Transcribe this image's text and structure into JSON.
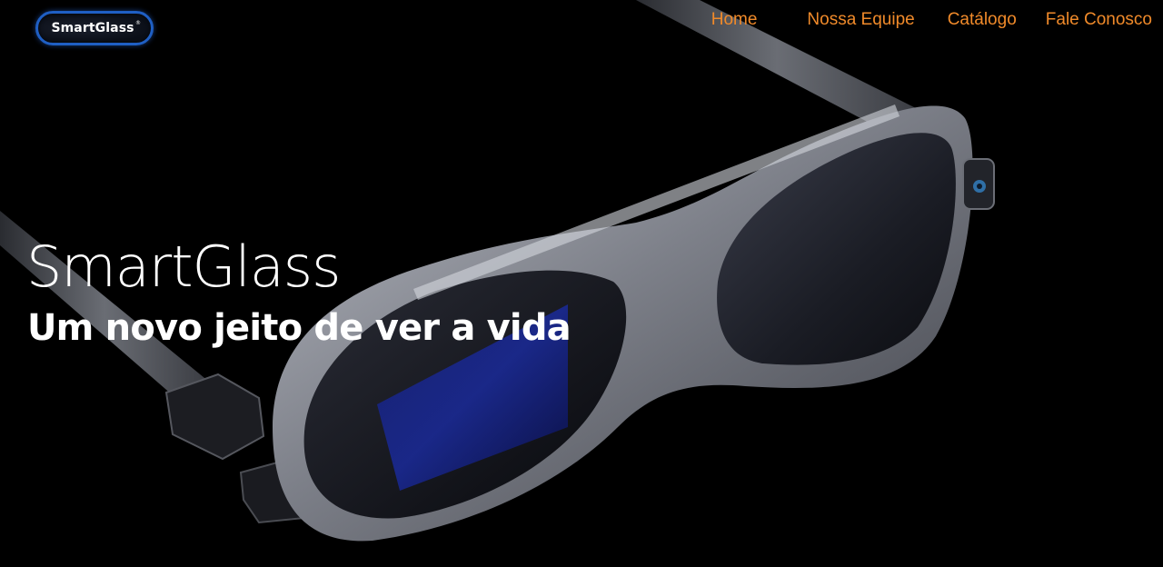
{
  "logo": {
    "text": "SmartGlass",
    "mark": "®"
  },
  "nav": {
    "items": [
      {
        "label": "Home"
      },
      {
        "label": "Nossa Equipe"
      },
      {
        "label": "Catálogo"
      },
      {
        "label": "Fale Conosco"
      }
    ]
  },
  "hero": {
    "title": "SmartGlass",
    "subtitle": "Um novo jeito de ver a vida"
  },
  "colors": {
    "background": "#000000",
    "nav_link": "#f08a2a",
    "hero_text": "#ffffff",
    "logo_border": "#1f5fc4"
  }
}
